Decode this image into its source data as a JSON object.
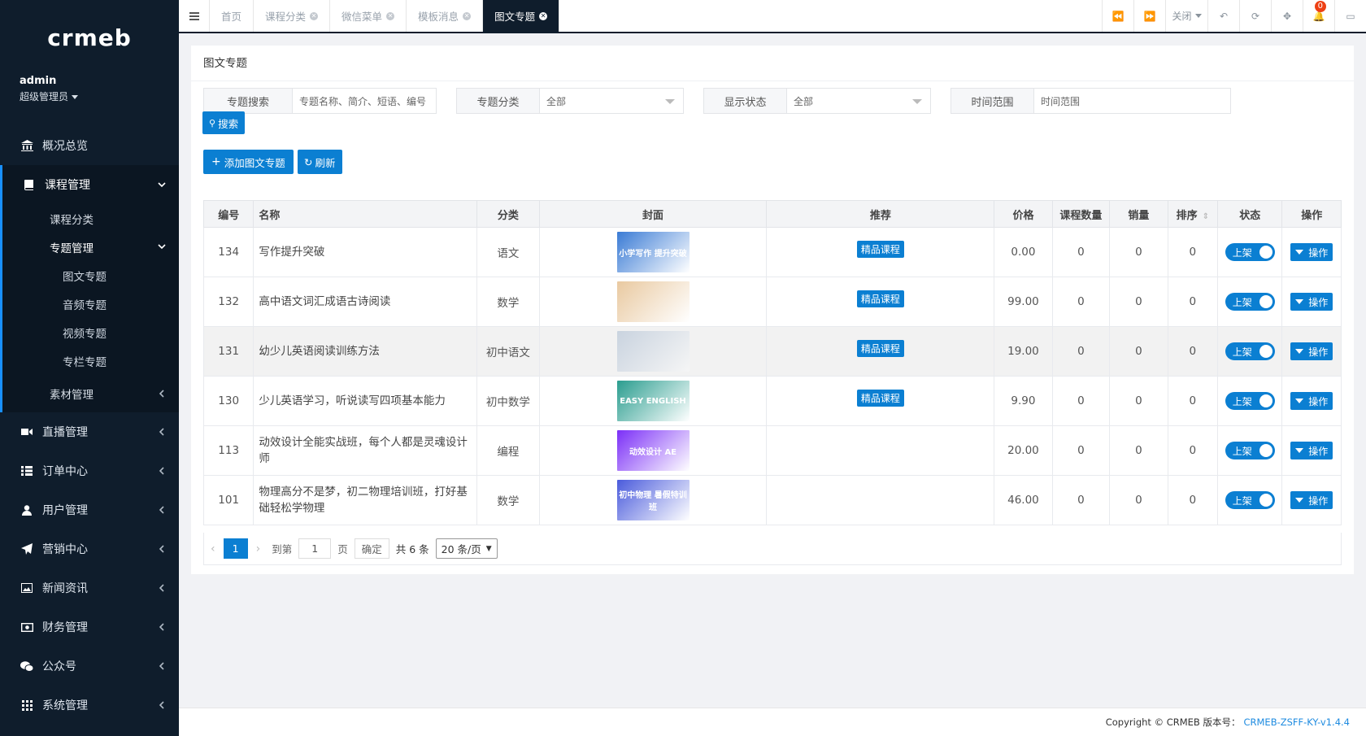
{
  "brand": {
    "logo": "crmeb"
  },
  "user": {
    "name": "admin",
    "role": "超级管理员"
  },
  "sidebar": {
    "overview": "概况总览",
    "course_mgmt": "课程管理",
    "course_category": "课程分类",
    "topic_mgmt": "专题管理",
    "topic_items": [
      "图文专题",
      "音频专题",
      "视频专题",
      "专栏专题"
    ],
    "material_mgmt": "素材管理",
    "items": [
      {
        "label": "直播管理",
        "icon": "video-icon"
      },
      {
        "label": "订单中心",
        "icon": "list-icon"
      },
      {
        "label": "用户管理",
        "icon": "user-icon"
      },
      {
        "label": "营销中心",
        "icon": "send-icon"
      },
      {
        "label": "新闻资讯",
        "icon": "image-icon"
      },
      {
        "label": "财务管理",
        "icon": "money-icon"
      },
      {
        "label": "公众号",
        "icon": "wechat-icon"
      },
      {
        "label": "系统管理",
        "icon": "grid-icon"
      }
    ]
  },
  "tabs": [
    {
      "label": "首页"
    },
    {
      "label": "课程分类"
    },
    {
      "label": "微信菜单"
    },
    {
      "label": "模板消息"
    },
    {
      "label": "图文专题"
    }
  ],
  "topbar": {
    "close": "关闭",
    "notifications": "0"
  },
  "page": {
    "title": "图文专题"
  },
  "filters": {
    "search_label": "专题搜索",
    "search_placeholder": "专题名称、简介、短语、编号",
    "category_label": "专题分类",
    "category_value": "全部",
    "status_label": "显示状态",
    "status_value": "全部",
    "time_label": "时间范围",
    "time_placeholder": "时间范围",
    "search_button": "搜索"
  },
  "actions": {
    "add": "添加图文专题",
    "refresh": "刷新"
  },
  "table": {
    "headers": {
      "id": "编号",
      "name": "名称",
      "category": "分类",
      "cover": "封面",
      "recommend": "推荐",
      "price": "价格",
      "count": "课程数量",
      "sales": "销量",
      "sort": "排序",
      "status": "状态",
      "ops": "操作"
    },
    "rows": [
      {
        "id": "134",
        "name": "写作提升突破",
        "category": "语文",
        "cover_text": "小学写作 提升突破",
        "cover_color": "#3a7bd5",
        "recommend": "精品课程",
        "price": "0.00",
        "count": "0",
        "sales": "0",
        "sort": "0",
        "status": "上架",
        "op": "操作"
      },
      {
        "id": "132",
        "name": "高中语文词汇成语古诗阅读",
        "category": "数学",
        "cover_text": "",
        "cover_color": "#e9c9a0",
        "recommend": "精品课程",
        "price": "99.00",
        "count": "0",
        "sales": "0",
        "sort": "0",
        "status": "上架",
        "op": "操作"
      },
      {
        "id": "131",
        "name": "幼少儿英语阅读训练方法",
        "category": "初中语文",
        "cover_text": "",
        "cover_color": "#c9d3df",
        "recommend": "精品课程",
        "price": "19.00",
        "count": "0",
        "sales": "0",
        "sort": "0",
        "status": "上架",
        "op": "操作"
      },
      {
        "id": "130",
        "name": "少儿英语学习，听说读写四项基本能力",
        "category": "初中数学",
        "cover_text": "EASY ENGLISH",
        "cover_color": "#2a9d8f",
        "recommend": "精品课程",
        "price": "9.90",
        "count": "0",
        "sales": "0",
        "sort": "0",
        "status": "上架",
        "op": "操作"
      },
      {
        "id": "113",
        "name": "动效设计全能实战班，每个人都是灵魂设计师",
        "category": "编程",
        "cover_text": "动效设计 AE",
        "cover_color": "#7b2ff7",
        "recommend": "",
        "price": "20.00",
        "count": "0",
        "sales": "0",
        "sort": "0",
        "status": "上架",
        "op": "操作"
      },
      {
        "id": "101",
        "name": "物理高分不是梦，初二物理培训班，打好基础轻松学物理",
        "category": "数学",
        "cover_text": "初中物理 暑假特训班",
        "cover_color": "#4a5bdc",
        "recommend": "",
        "price": "46.00",
        "count": "0",
        "sales": "0",
        "sort": "0",
        "status": "上架",
        "op": "操作"
      }
    ]
  },
  "pager": {
    "current": "1",
    "goto": "到第",
    "page_input": "1",
    "page": "页",
    "confirm": "确定",
    "total": "共 6 条",
    "per_page": "20 条/页"
  },
  "footer": {
    "copyright": "Copyright © CRMEB 版本号：",
    "version": "CRMEB-ZSFF-KY-v1.4.4"
  }
}
